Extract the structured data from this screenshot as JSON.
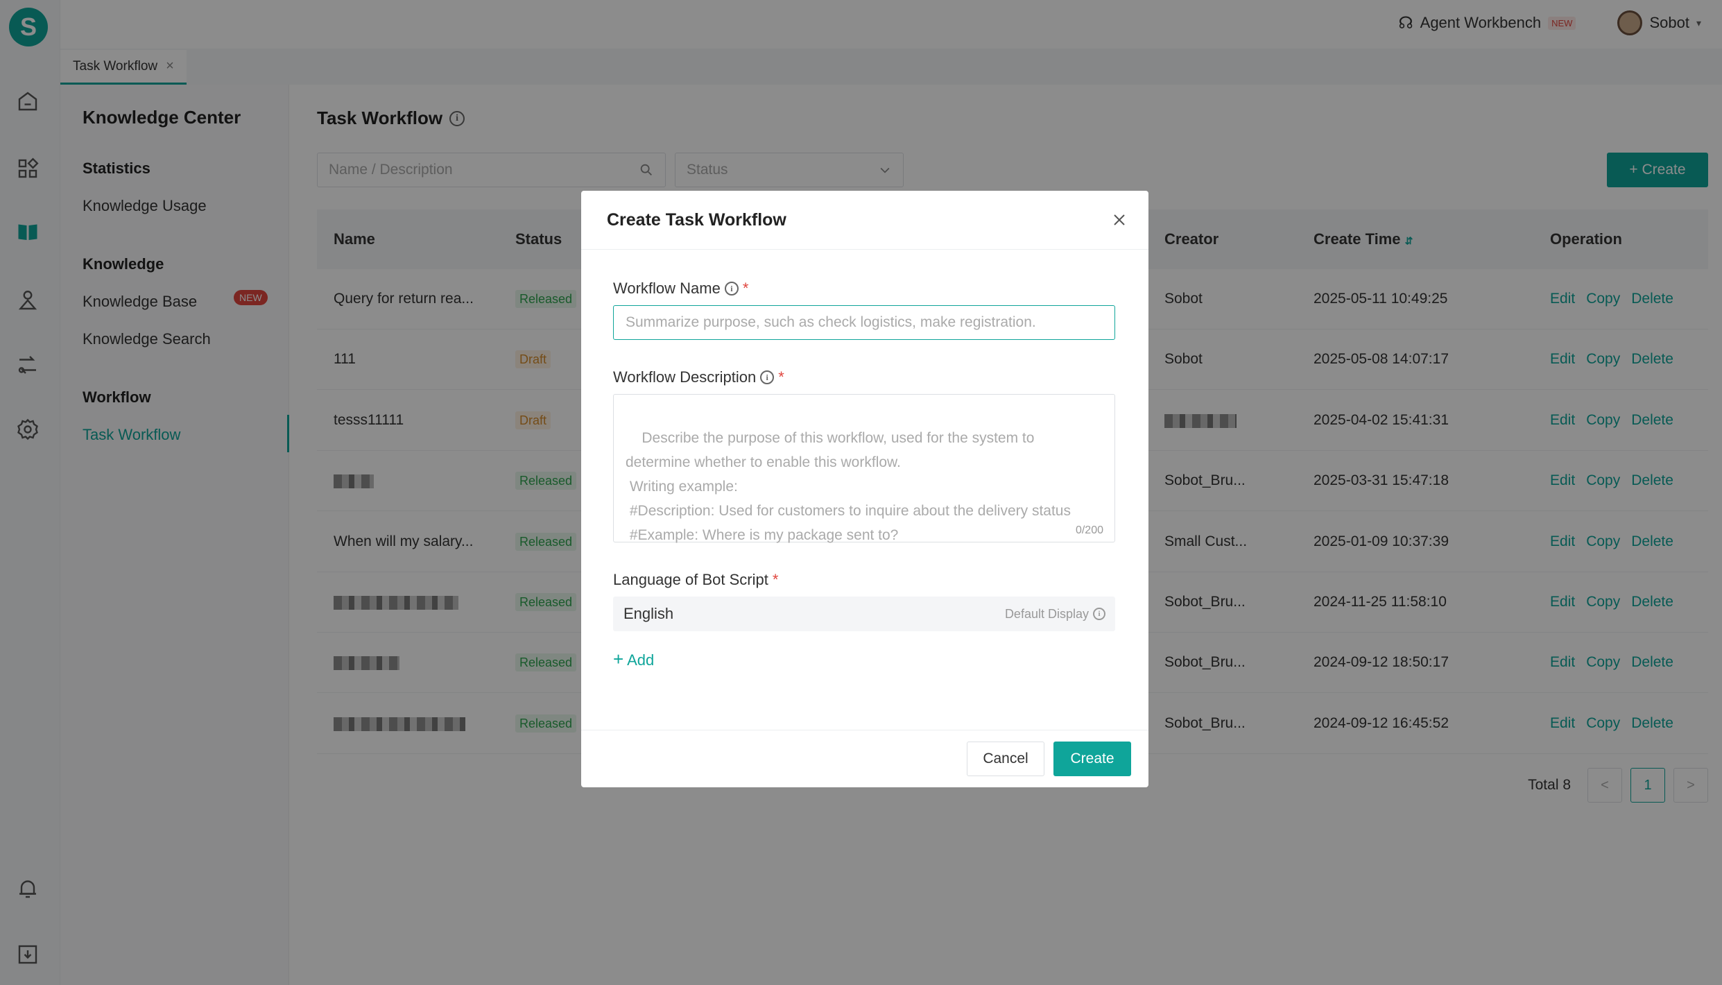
{
  "topbar": {
    "workbench_label": "Agent Workbench",
    "workbench_badge": "NEW",
    "user_name": "Sobot"
  },
  "logo_letter": "S",
  "tabs": [
    {
      "label": "Task Workflow",
      "close": "×"
    }
  ],
  "sidenav": {
    "title": "Knowledge Center",
    "groups": [
      {
        "label": "Statistics",
        "items": [
          "Knowledge Usage"
        ]
      },
      {
        "label": "Knowledge",
        "items": [
          "Knowledge Base",
          "Knowledge Search"
        ],
        "badge": "NEW"
      },
      {
        "label": "Workflow",
        "items": [
          "Task Workflow"
        ]
      }
    ]
  },
  "page": {
    "title": "Task Workflow",
    "search_placeholder": "Name / Description",
    "status_placeholder": "Status",
    "create_label": "+ Create"
  },
  "table": {
    "headers": [
      "Name",
      "Status",
      "Creator",
      "Create Time",
      "Operation"
    ],
    "ops": [
      "Edit",
      "Copy",
      "Delete"
    ],
    "rows": [
      {
        "name": "Query for return rea...",
        "status": "Released",
        "creator": "Sobot",
        "time": "2025-05-11 10:49:25"
      },
      {
        "name": "111",
        "status": "Draft",
        "creator": "Sobot",
        "time": "2025-05-08 14:07:17"
      },
      {
        "name": "tesss11111",
        "status": "Draft",
        "creator": "",
        "time": "2025-04-02 15:41:31"
      },
      {
        "name": "",
        "status": "Released",
        "creator": "Sobot_Bru...",
        "time": "2025-03-31 15:47:18"
      },
      {
        "name": "When will my salary...",
        "status": "Released",
        "creator": "Small Cust...",
        "time": "2025-01-09 10:37:39"
      },
      {
        "name": "",
        "status": "Released",
        "creator": "Sobot_Bru...",
        "time": "2024-11-25 11:58:10"
      },
      {
        "name": "",
        "status": "Released",
        "creator": "Sobot_Bru...",
        "time": "2024-09-12 18:50:17"
      },
      {
        "name": "",
        "status": "Released",
        "creator": "Sobot_Bru...",
        "time": "2024-09-12 16:45:52"
      }
    ]
  },
  "pager": {
    "total": "Total 8",
    "current": "1",
    "prev": "<",
    "next": ">"
  },
  "modal": {
    "title": "Create Task Workflow",
    "name_label": "Workflow Name",
    "name_placeholder": "Summarize purpose, such as check logistics, make registration.",
    "desc_label": "Workflow Description",
    "desc_placeholder": "Describe the purpose of this workflow, used for the system to determine whether to enable this workflow.\n Writing example:\n #Description: Used for customers to inquire about the delivery status\n #Example: Where is my package sent to?",
    "desc_counter": "0/200",
    "lang_label": "Language of Bot Script",
    "lang_value": "English",
    "lang_default": "Default Display",
    "add_label": "Add",
    "cancel_label": "Cancel",
    "create_label": "Create",
    "required_mark": "*"
  }
}
